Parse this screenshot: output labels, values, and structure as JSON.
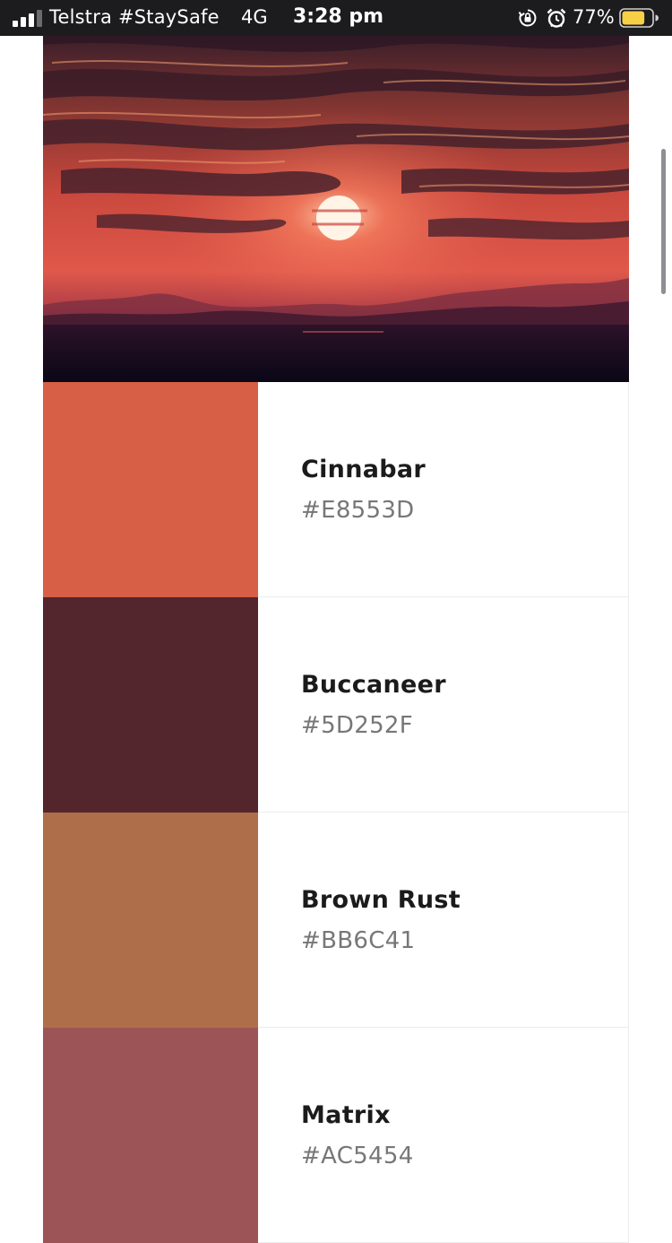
{
  "status_bar": {
    "carrier": "Telstra #StaySafe",
    "network": "4G",
    "time": "3:28 pm",
    "battery_percent": "77%",
    "icons": [
      "signal-icon",
      "orientation-lock-icon",
      "alarm-icon",
      "battery-icon"
    ],
    "battery_level": 0.77,
    "battery_color": "#F7D046"
  },
  "hero": {
    "icon": "sunset-photo"
  },
  "swatches": [
    {
      "name": "Cinnabar",
      "hex": "#E8553D",
      "display_color": "#D65F45"
    },
    {
      "name": "Buccaneer",
      "hex": "#5D252F",
      "display_color": "#53252D"
    },
    {
      "name": "Brown Rust",
      "hex": "#BB6C41",
      "display_color": "#AE6E49"
    },
    {
      "name": "Matrix",
      "hex": "#AC5454",
      "display_color": "#9D5456"
    }
  ]
}
